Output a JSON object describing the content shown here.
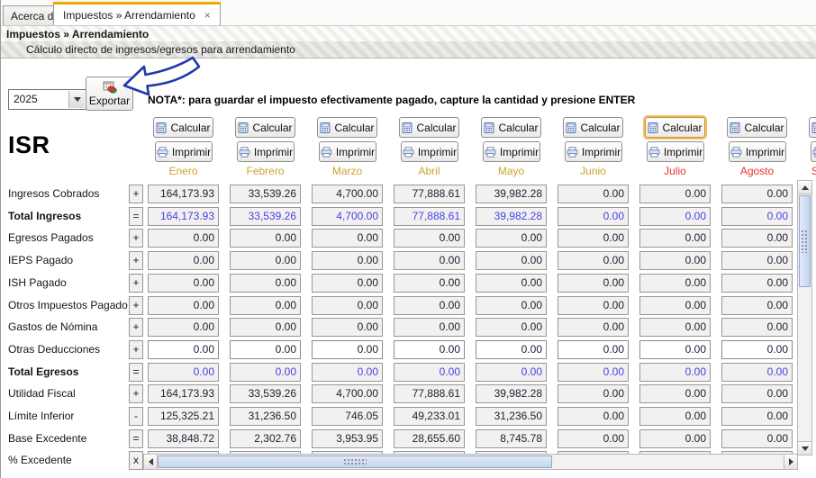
{
  "tabs": [
    {
      "label": "Acerca de"
    },
    {
      "label": "Impuestos » Arrendamiento",
      "close": "×",
      "active": true
    }
  ],
  "header": {
    "title": "Impuestos » Arrendamiento",
    "subtitle": "Cálculo directo de ingresos/egresos para arrendamiento"
  },
  "controls": {
    "year": "2025",
    "export_label": "Exportar",
    "note": "NOTA*: para guardar el impuesto efectivamente pagado, capture la cantidad y presione ENTER"
  },
  "section_title": "ISR",
  "grid": {
    "calcular_label": "Calcular",
    "imprimir_label": "Imprimir"
  },
  "months": [
    {
      "name": "Enero",
      "color": "gold"
    },
    {
      "name": "Febrero",
      "color": "gold"
    },
    {
      "name": "Marzo",
      "color": "gold"
    },
    {
      "name": "Abril",
      "color": "gold"
    },
    {
      "name": "Mayo",
      "color": "gold"
    },
    {
      "name": "Junio",
      "color": "gold"
    },
    {
      "name": "Julio",
      "color": "red",
      "focused": true
    },
    {
      "name": "Agosto",
      "color": "red"
    },
    {
      "name": "Septiembre",
      "color": "red",
      "partial": true
    }
  ],
  "rows": [
    {
      "label": "Ingresos Cobrados",
      "op": "+",
      "bold": false,
      "style": "normal",
      "values": [
        "164,173.93",
        "33,539.26",
        "4,700.00",
        "77,888.61",
        "39,982.28",
        "0.00",
        "0.00",
        "0.00"
      ]
    },
    {
      "label": "Total Ingresos",
      "op": "=",
      "bold": true,
      "style": "total",
      "values": [
        "164,173.93",
        "33,539.26",
        "4,700.00",
        "77,888.61",
        "39,982.28",
        "0.00",
        "0.00",
        "0.00"
      ]
    },
    {
      "label": "Egresos Pagados",
      "op": "+",
      "bold": false,
      "style": "normal",
      "values": [
        "0.00",
        "0.00",
        "0.00",
        "0.00",
        "0.00",
        "0.00",
        "0.00",
        "0.00"
      ]
    },
    {
      "label": "IEPS Pagado",
      "op": "+",
      "bold": false,
      "style": "normal",
      "values": [
        "0.00",
        "0.00",
        "0.00",
        "0.00",
        "0.00",
        "0.00",
        "0.00",
        "0.00"
      ]
    },
    {
      "label": "ISH Pagado",
      "op": "+",
      "bold": false,
      "style": "normal",
      "values": [
        "0.00",
        "0.00",
        "0.00",
        "0.00",
        "0.00",
        "0.00",
        "0.00",
        "0.00"
      ]
    },
    {
      "label": "Otros Impuestos Pagado",
      "op": "+",
      "bold": false,
      "style": "normal",
      "values": [
        "0.00",
        "0.00",
        "0.00",
        "0.00",
        "0.00",
        "0.00",
        "0.00",
        "0.00"
      ]
    },
    {
      "label": "Gastos de Nómina",
      "op": "+",
      "bold": false,
      "style": "normal",
      "values": [
        "0.00",
        "0.00",
        "0.00",
        "0.00",
        "0.00",
        "0.00",
        "0.00",
        "0.00"
      ]
    },
    {
      "label": "Otras Deducciones",
      "op": "+",
      "bold": false,
      "style": "editable",
      "values": [
        "0.00",
        "0.00",
        "0.00",
        "0.00",
        "0.00",
        "0.00",
        "0.00",
        "0.00"
      ]
    },
    {
      "label": "Total Egresos",
      "op": "=",
      "bold": true,
      "style": "total",
      "values": [
        "0.00",
        "0.00",
        "0.00",
        "0.00",
        "0.00",
        "0.00",
        "0.00",
        "0.00"
      ]
    },
    {
      "label": "Utilidad Fiscal",
      "op": "+",
      "bold": false,
      "style": "normal",
      "values": [
        "164,173.93",
        "33,539.26",
        "4,700.00",
        "77,888.61",
        "39,982.28",
        "0.00",
        "0.00",
        "0.00"
      ]
    },
    {
      "label": "Límite Inferior",
      "op": "-",
      "bold": false,
      "style": "normal",
      "values": [
        "125,325.21",
        "31,236.50",
        "746.05",
        "49,233.01",
        "31,236.50",
        "0.00",
        "0.00",
        "0.00"
      ]
    },
    {
      "label": "Base Excedente",
      "op": "=",
      "bold": false,
      "style": "normal",
      "values": [
        "38,848.72",
        "2,302.76",
        "3,953.95",
        "28,655.60",
        "8,745.78",
        "0.00",
        "0.00",
        "0.00"
      ]
    },
    {
      "label": "% Excedente",
      "op": "x",
      "bold": false,
      "style": "covered",
      "values": [
        "",
        "",
        "",
        "",
        "",
        "",
        "",
        ""
      ]
    }
  ],
  "colors": {
    "month_gold": "#cfa22e",
    "month_red": "#e5342c",
    "total_blue": "#4543e6",
    "tab_accent": "#f8a400"
  }
}
